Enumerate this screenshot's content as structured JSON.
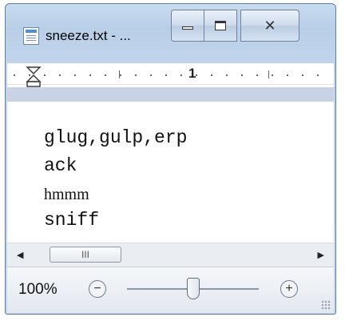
{
  "window": {
    "title": "sneeze.txt - ...",
    "icons": {
      "app": "notepad-document-icon",
      "minimize": "minimize-icon",
      "maximize": "maximize-icon",
      "close": "close-icon"
    }
  },
  "ruler": {
    "label": "1",
    "icon": "indent-marker-icon"
  },
  "document": {
    "lines": [
      "glug,gulp,erp",
      "ack",
      "hmmm",
      "sniff"
    ]
  },
  "scrollbar": {
    "thumb_glyph": "III",
    "left_arrow": "◀",
    "right_arrow": "▶"
  },
  "statusbar": {
    "zoom_level": "100%",
    "zoom_out_glyph": "−",
    "zoom_in_glyph": "+",
    "zoom_slider_fraction": 0.5
  },
  "colors": {
    "window_frame": "#c4d7ec",
    "border": "#5f7fa3"
  }
}
